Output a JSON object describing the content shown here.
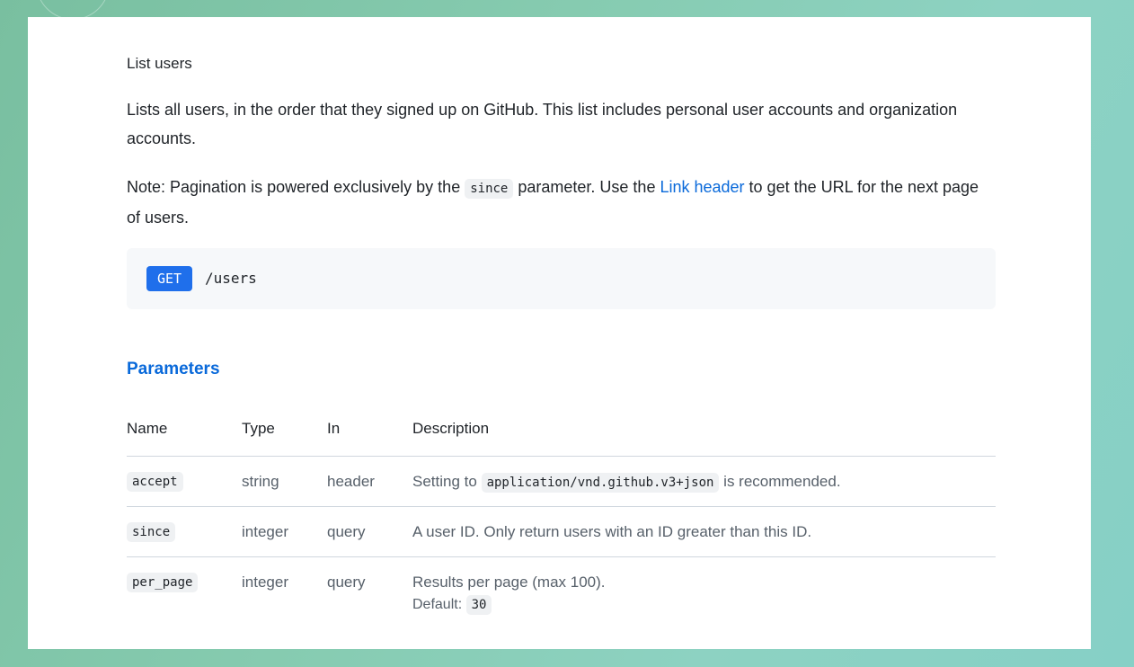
{
  "title": "List users",
  "description": "Lists all users, in the order that they signed up on GitHub. This list includes personal user accounts and organization accounts.",
  "note": {
    "prefix": "Note: Pagination is powered exclusively by the ",
    "code": "since",
    "middle": " parameter. Use the ",
    "link_text": "Link header",
    "suffix": " to get the URL for the next page of users."
  },
  "endpoint": {
    "method": "GET",
    "path": "/users",
    "method_color": "#1f6feb"
  },
  "parameters": {
    "heading": "Parameters",
    "columns": [
      "Name",
      "Type",
      "In",
      "Description"
    ],
    "rows": [
      {
        "name": "accept",
        "type": "string",
        "in": "header",
        "desc_prefix": "Setting to ",
        "desc_code": "application/vnd.github.v3+json",
        "desc_suffix": " is recommended."
      },
      {
        "name": "since",
        "type": "integer",
        "in": "query",
        "description": "A user ID. Only return users with an ID greater than this ID."
      },
      {
        "name": "per_page",
        "type": "integer",
        "in": "query",
        "description": "Results per page (max 100).",
        "default_label": "Default:",
        "default_value": "30"
      }
    ]
  },
  "colors": {
    "link": "#0969da",
    "text": "#1f2328",
    "muted": "#57606a",
    "code_bg": "#eff1f3"
  }
}
